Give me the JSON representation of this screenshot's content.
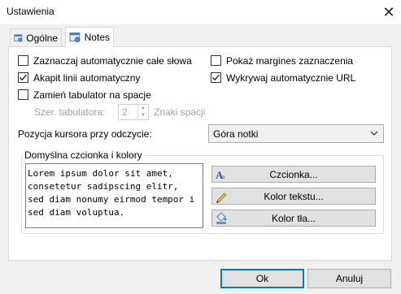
{
  "window": {
    "title": "Ustawienia",
    "close_glyph": "✕"
  },
  "tabs": [
    {
      "label": "Ogólne",
      "icon": "general-settings-icon",
      "active": false
    },
    {
      "label": "Notes",
      "icon": "notes-settings-icon",
      "active": true
    }
  ],
  "options": {
    "select_whole_words": {
      "label": "Zaznaczaj automatycznie całe słowa",
      "checked": false
    },
    "auto_paragraph": {
      "label": "Akapit linii automatyczny",
      "checked": true
    },
    "replace_tabs": {
      "label": "Zamień tabulator na spacje",
      "checked": false
    },
    "show_selection_margin": {
      "label": "Pokaż margines zaznaczenia",
      "checked": false
    },
    "detect_urls": {
      "label": "Wykrywaj automatycznie URL",
      "checked": true
    }
  },
  "tab_width": {
    "label": "Szer. tabulatora:",
    "value": "2",
    "unit": "Znaki spacji"
  },
  "cursor_position": {
    "label": "Pozycja kursora przy odczycie:",
    "selected": "Góra notki"
  },
  "font_group": {
    "title": "Domyślna czcionka i kolory",
    "preview_text": "Lorem ipsum dolor sit amet,\nconsetetur sadipscing elitr,\nsed diam nonumy eirmod tempor i\nsed diam voluptua.",
    "font_button": "Czcionka...",
    "text_color_button": "Kolor tekstu...",
    "bg_color_button": "Kolor tła..."
  },
  "footer": {
    "ok": "Ok",
    "cancel": "Anuluj"
  },
  "colors": {
    "accent": "#0078d7",
    "panel": "#ffffff",
    "window_bg": "#f0f0f0"
  }
}
